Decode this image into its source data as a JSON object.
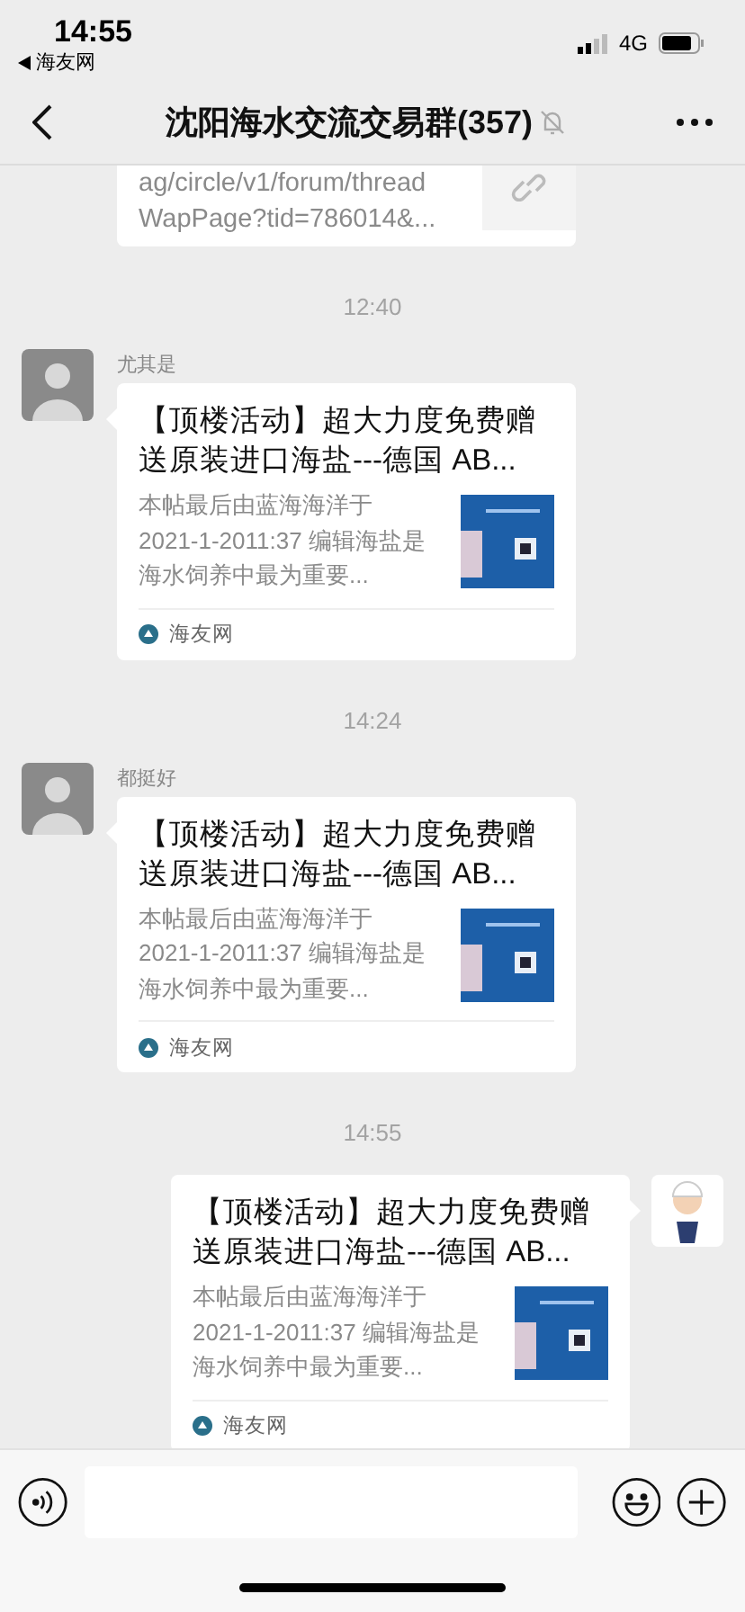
{
  "status_bar": {
    "time": "14:55",
    "back_app": "海友网",
    "network": "4G"
  },
  "nav": {
    "title": "沈阳海水交流交易群(357)",
    "muted": true
  },
  "messages": [
    {
      "kind": "partial_card",
      "lines": [
        "ag/circle/v1/forum/thread",
        "WapPage?tid=786014&..."
      ]
    },
    {
      "kind": "time",
      "text": "12:40"
    },
    {
      "kind": "card",
      "outgoing": false,
      "sender": "尤其是",
      "title": "【顶楼活动】超大力度免费赠送原装进口海盐---德国 AB...",
      "desc": "本帖最后由蓝海海洋于2021-1-2011:37 编辑海盐是海水饲养中最为重要...",
      "source": "海友网"
    },
    {
      "kind": "time",
      "text": "14:24"
    },
    {
      "kind": "card",
      "outgoing": false,
      "sender": "都挺好",
      "title": "【顶楼活动】超大力度免费赠送原装进口海盐---德国 AB...",
      "desc": "本帖最后由蓝海海洋于2021-1-2011:37 编辑海盐是海水饲养中最为重要...",
      "source": "海友网"
    },
    {
      "kind": "time",
      "text": "14:55"
    },
    {
      "kind": "card",
      "outgoing": true,
      "title": "【顶楼活动】超大力度免费赠送原装进口海盐---德国 AB...",
      "desc": "本帖最后由蓝海海洋于2021-1-2011:37 编辑海盐是海水饲养中最为重要...",
      "source": "海友网"
    }
  ]
}
